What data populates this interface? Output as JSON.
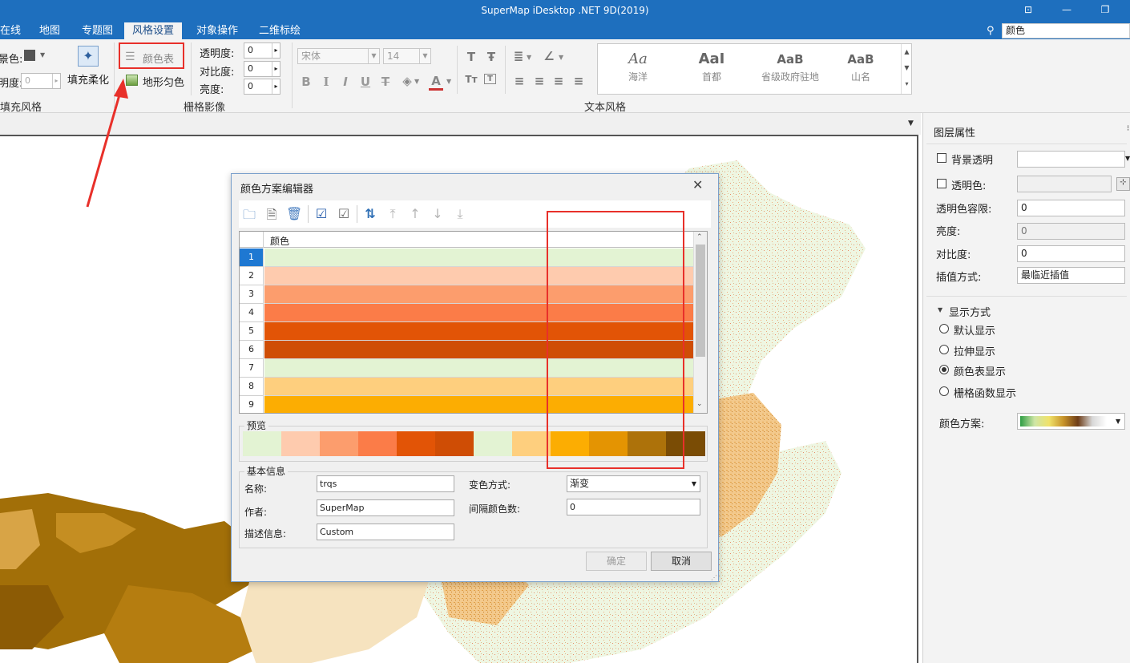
{
  "app": {
    "title": "SuperMap iDesktop .NET 9D(2019)"
  },
  "tabs": [
    "在线",
    "地图",
    "专题图",
    "风格设置",
    "对象操作",
    "二维标绘"
  ],
  "search": {
    "value": "颜色"
  },
  "ribbon": {
    "fill_color_label": "景色:",
    "brightness_label": "明度:",
    "brightness_value": "0",
    "fill_soften_label": "填充柔化",
    "fill_style_group": "填充风格",
    "color_table_label": "颜色表",
    "terrain_label": "地形匀色",
    "transparency_label": "透明度:",
    "contrast_label": "对比度:",
    "brightness2_label": "亮度:",
    "transparency_value": "0",
    "contrast_value": "0",
    "brightness2_value": "0",
    "raster_group": "栅格影像",
    "font_name": "宋体",
    "font_size": "14",
    "text_group": "文本风格",
    "gallery": [
      {
        "sample": "Aa",
        "label": "海洋"
      },
      {
        "sample": "AaI",
        "label": "首都"
      },
      {
        "sample": "AaB",
        "label": "省级政府驻地"
      },
      {
        "sample": "AaB",
        "label": "山名"
      }
    ]
  },
  "right_panel": {
    "title": "图层属性",
    "bg_transparent": "背景透明",
    "transparent_color": "透明色:",
    "tolerance_label": "透明色容限:",
    "tolerance_value": "0",
    "brightness_label": "亮度:",
    "brightness_value": "0",
    "contrast_label": "对比度:",
    "contrast_value": "0",
    "interp_label": "插值方式:",
    "interp_value": "最临近插值",
    "display_mode": "显示方式",
    "modes": [
      "默认显示",
      "拉伸显示",
      "颜色表显示",
      "栅格函数显示"
    ],
    "selected_mode": 2,
    "scheme_label": "颜色方案:"
  },
  "dialog": {
    "title": "颜色方案编辑器",
    "grid_header": "颜色",
    "rows": [
      {
        "no": "1",
        "color": "#e3f3d3"
      },
      {
        "no": "2",
        "color": "#fecbae"
      },
      {
        "no": "3",
        "color": "#fc9d6d"
      },
      {
        "no": "4",
        "color": "#fb7c48"
      },
      {
        "no": "5",
        "color": "#e25406"
      },
      {
        "no": "6",
        "color": "#cf4d05"
      },
      {
        "no": "7",
        "color": "#e3f3d3"
      },
      {
        "no": "8",
        "color": "#fecf7e"
      },
      {
        "no": "9",
        "color": "#fcad02"
      }
    ],
    "preview_label": "预览",
    "preview_colors": [
      "#e3f3d3",
      "#fecbae",
      "#fc9d6d",
      "#fb7c48",
      "#e25406",
      "#cf4d05",
      "#e3f3d3",
      "#fecf7e",
      "#fcad02",
      "#e49402",
      "#ad720a",
      "#7a4c05"
    ],
    "basic_label": "基本信息",
    "name_label": "名称:",
    "name_value": "trqs",
    "author_label": "作者:",
    "author_value": "SuperMap",
    "desc_label": "描述信息:",
    "desc_value": "Custom",
    "change_label": "变色方式:",
    "change_value": "渐变",
    "interval_label": "间隔颜色数:",
    "interval_value": "0",
    "ok": "确定",
    "cancel": "取消"
  }
}
